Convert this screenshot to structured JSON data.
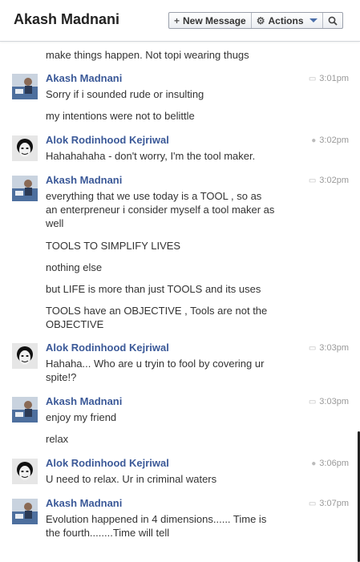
{
  "header": {
    "title": "Akash Madnani",
    "new_message_label": "New Message",
    "actions_label": "Actions"
  },
  "thread": {
    "partial_text": "make things happen. Not topi wearing thugs",
    "messages": [
      {
        "sender": "Akash Madnani",
        "time": "3:01pm",
        "icon": "speech-bubble-icon",
        "lines": [
          "Sorry if i sounded rude or insulting",
          "my intentions were not to belittle"
        ]
      },
      {
        "sender": "Alok Rodinhood Kejriwal",
        "time": "3:02pm",
        "icon": "location-pin-icon",
        "lines": [
          "Hahahahaha - don't worry, I'm the tool maker."
        ]
      },
      {
        "sender": "Akash Madnani",
        "time": "3:02pm",
        "icon": "speech-bubble-icon",
        "lines": [
          "everything that we use today is a TOOL , so as",
          "an enterpreneur i consider myself a tool maker as",
          "well",
          "TOOLS TO SIMPLIFY LIVES",
          "nothing else",
          "but LIFE is more than just TOOLS and its uses",
          "TOOLS have an OBJECTIVE , Tools are not the",
          "OBJECTIVE"
        ]
      },
      {
        "sender": "Alok Rodinhood Kejriwal",
        "time": "3:03pm",
        "icon": "speech-bubble-icon",
        "lines": [
          "Hahaha... Who are u tryin to fool by covering ur",
          "spite!?"
        ]
      },
      {
        "sender": "Akash Madnani",
        "time": "3:03pm",
        "icon": "speech-bubble-icon",
        "lines": [
          "enjoy my friend",
          "relax"
        ]
      },
      {
        "sender": "Alok Rodinhood Kejriwal",
        "time": "3:06pm",
        "icon": "location-pin-icon",
        "lines": [
          "U need to relax. Ur in criminal waters"
        ]
      },
      {
        "sender": "Akash Madnani",
        "time": "3:07pm",
        "icon": "speech-bubble-icon",
        "lines": [
          "Evolution happened in 4 dimensions...... Time is",
          "the fourth........Time will tell"
        ]
      }
    ]
  }
}
